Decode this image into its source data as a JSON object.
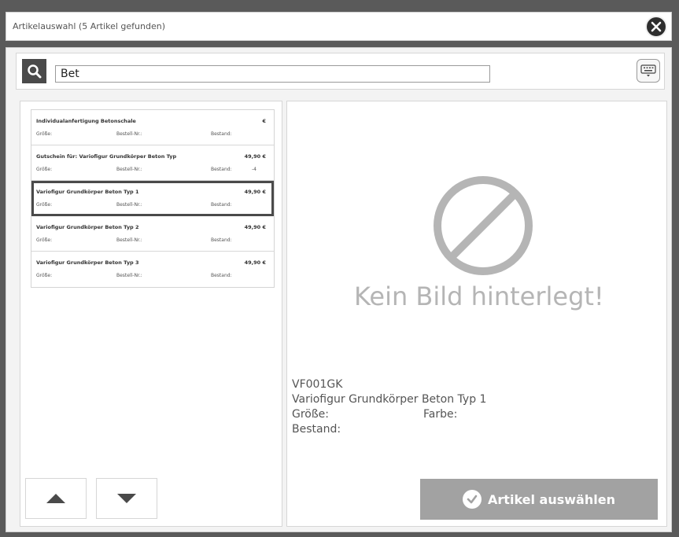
{
  "window": {
    "title": "Artikelauswahl (5 Artikel gefunden)"
  },
  "search": {
    "value": "Bet"
  },
  "list_labels": {
    "groesse": "Größe:",
    "bestellnr": "Bestell-Nr.:",
    "bestand": "Bestand:"
  },
  "items": [
    {
      "name": "Individualanfertigung Betonschale",
      "price": "€",
      "bestand": ""
    },
    {
      "name": "Gutschein für: Variofigur Grundkörper Beton Typ",
      "price": "49,90 €",
      "bestand": "-4"
    },
    {
      "name": "Variofigur Grundkörper Beton Typ 1",
      "price": "49,90 €",
      "bestand": ""
    },
    {
      "name": "Variofigur Grundkörper Beton Typ 2",
      "price": "49,90 €",
      "bestand": ""
    },
    {
      "name": "Variofigur Grundkörper Beton Typ 3",
      "price": "49,90 €",
      "bestand": ""
    }
  ],
  "selected_index": 2,
  "preview": {
    "no_image_text": "Kein Bild hinterlegt!",
    "article_number": "VF001GK",
    "article_name": "Variofigur Grundkörper Beton Typ 1",
    "groesse_label": "Größe:",
    "farbe_label": "Farbe:",
    "bestand_label": "Bestand:"
  },
  "actions": {
    "select_label": "Artikel auswählen"
  },
  "icons": {
    "close": "close-icon",
    "search": "search-icon",
    "keyboard": "keyboard-icon",
    "up": "arrow-up-icon",
    "down": "arrow-down-icon",
    "check": "check-icon",
    "no_image": "no-image-icon"
  },
  "colors": {
    "frame": "#5a5a5a",
    "accent_dark": "#4a4a4a",
    "button_disabled": "#a2a2a2",
    "placeholder_gray": "#b5b5b5"
  }
}
